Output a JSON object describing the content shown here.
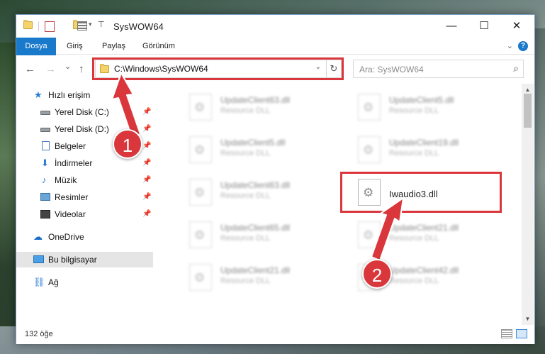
{
  "window": {
    "title": "SysWOW64",
    "minimize": "—",
    "maximize": "☐",
    "close": "✕"
  },
  "ribbon": {
    "tabs": [
      "Dosya",
      "Giriş",
      "Paylaş",
      "Görünüm"
    ],
    "help": "?"
  },
  "nav": {
    "back": "←",
    "forward": "→",
    "recent": "⌄",
    "up": "↑",
    "address": "C:\\Windows\\SysWOW64",
    "address_dropdown": "⌄",
    "refresh": "↻",
    "search_placeholder": "Ara: SysWOW64",
    "search_icon": "⌕"
  },
  "sidebar": {
    "items": [
      {
        "label": "Hızlı erişim",
        "icon": "star-icon"
      },
      {
        "label": "Yerel Disk (C:)",
        "icon": "drive-icon",
        "pinned": true
      },
      {
        "label": "Yerel Disk (D:)",
        "icon": "drive-icon",
        "pinned": true
      },
      {
        "label": "Belgeler",
        "icon": "document-icon",
        "pinned": true
      },
      {
        "label": "İndirmeler",
        "icon": "download-icon",
        "pinned": true
      },
      {
        "label": "Müzik",
        "icon": "music-icon",
        "pinned": true
      },
      {
        "label": "Resimler",
        "icon": "pictures-icon",
        "pinned": true
      },
      {
        "label": "Videolar",
        "icon": "videos-icon",
        "pinned": true
      },
      {
        "label": "OneDrive",
        "icon": "cloud-icon"
      },
      {
        "label": "Bu bilgisayar",
        "icon": "computer-icon",
        "selected": true
      },
      {
        "label": "Ağ",
        "icon": "network-icon"
      }
    ]
  },
  "files": [
    {
      "name": "UpdateClient63.dll",
      "type": "Resource DLL",
      "blurred": true
    },
    {
      "name": "UpdateClient5.dll",
      "type": "Resource DLL",
      "blurred": true
    },
    {
      "name": "UpdateClient5.dll",
      "type": "Resource DLL",
      "blurred": true
    },
    {
      "name": "UpdateClient19.dll",
      "type": "Resource DLL",
      "blurred": true
    },
    {
      "name": "UpdateClient63.dll",
      "type": "Resource DLL",
      "blurred": true
    },
    {
      "name": "Iwaudio3.dll",
      "type": "",
      "blurred": false
    },
    {
      "name": "UpdateClient65.dll",
      "type": "Resource DLL",
      "blurred": true
    },
    {
      "name": "UpdateClient21.dll",
      "type": "Resource DLL",
      "blurred": true
    },
    {
      "name": "UpdateClient21.dll",
      "type": "Resource DLL",
      "blurred": true
    },
    {
      "name": "UpdateClient42.dll",
      "type": "Resource DLL",
      "blurred": true
    }
  ],
  "status": {
    "count": "132 öğe"
  },
  "annotations": {
    "step1": "1",
    "step2": "2",
    "color": "#d9373c"
  },
  "colors": {
    "accent": "#1979ca",
    "highlight": "#d9373c"
  }
}
